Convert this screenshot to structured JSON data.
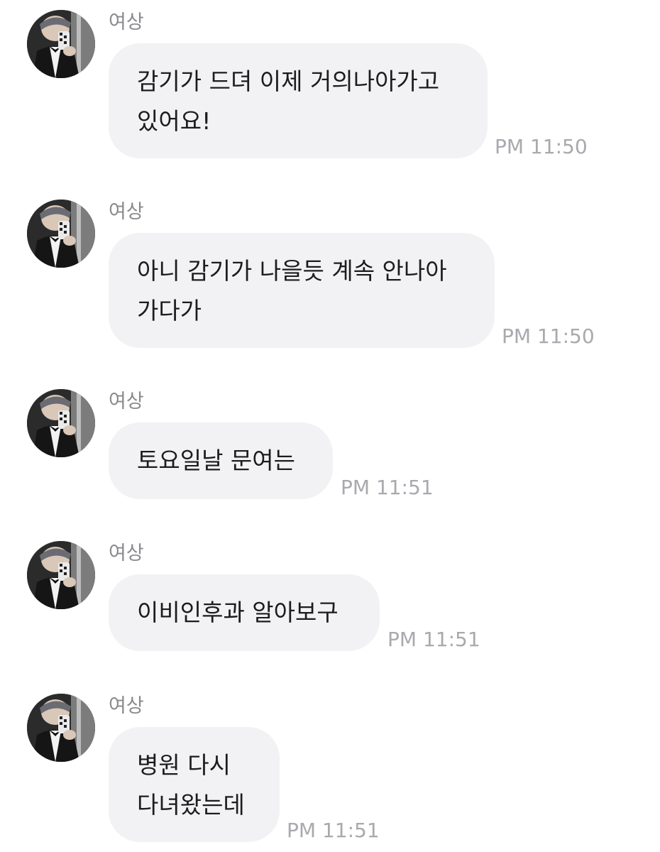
{
  "messages": [
    {
      "sender": "여상",
      "text": "감기가 드뎌 이제 거의나아가고\n있어요!",
      "time": "PM 11:50"
    },
    {
      "sender": "여상",
      "text": "아니 감기가 나을듯 계속 안나아\n가다가",
      "time": "PM 11:50"
    },
    {
      "sender": "여상",
      "text": "토요일날 문여는",
      "time": "PM 11:51"
    },
    {
      "sender": "여상",
      "text": "이비인후과 알아보구",
      "time": "PM 11:51"
    },
    {
      "sender": "여상",
      "text": "병원 다시\n다녀왔는데",
      "time": "PM 11:51"
    }
  ],
  "colors": {
    "bubble_bg": "#f2f2f4",
    "sender_text": "#8a8a8e",
    "time_text": "#a9a9ae",
    "message_text": "#1c1c1e"
  }
}
